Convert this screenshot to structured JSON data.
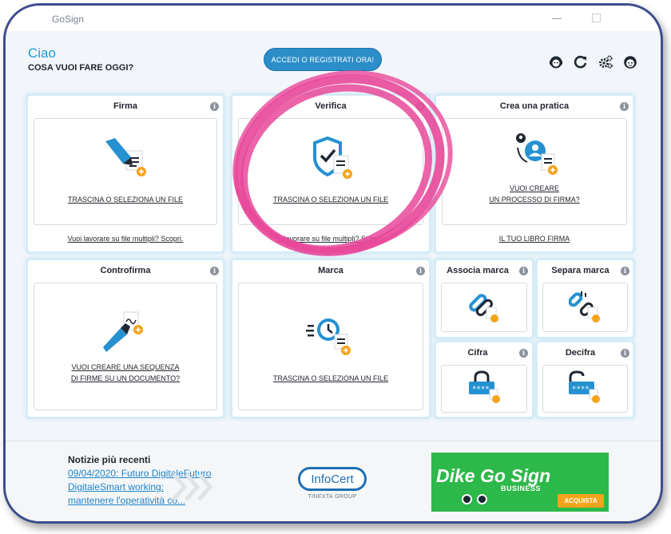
{
  "window": {
    "title": "GoSign"
  },
  "header": {
    "greeting": "Ciao",
    "question": "COSA VUOI FARE OGGI?",
    "login_button": "ACCEDI O REGISTRATI ORA!",
    "icons": [
      "user-support-icon",
      "refresh-icon",
      "settings-icon",
      "account-icon"
    ]
  },
  "panels": {
    "firma": {
      "title": "Firma",
      "action": "TRASCINA O SELEZIONA UN FILE",
      "footer_link": "Vuoi lavorare su file multipli? Scopri."
    },
    "verifica": {
      "title": "Verifica",
      "action": "TRASCINA O SELEZIONA UN FILE",
      "footer_link": "...lavorare su file multipli? Scopri."
    },
    "pratica": {
      "title": "Crea una pratica",
      "action_line1": "VUOI CREARE",
      "action_line2": "UN PROCESSO DI FIRMA?",
      "footer_link": "IL TUO LIBRO FIRMA"
    },
    "controfirma": {
      "title": "Controfirma",
      "action_line1": "VUOI CREARE UNA SEQUENZA",
      "action_line2": "DI FIRME SU UN DOCUMENTO?"
    },
    "marca": {
      "title": "Marca",
      "action": "TRASCINA O SELEZIONA UN FILE"
    },
    "associa_marca": {
      "title": "Associa marca"
    },
    "separa_marca": {
      "title": "Separa marca"
    },
    "cifra": {
      "title": "Cifra"
    },
    "decifra": {
      "title": "Decifra"
    }
  },
  "footer": {
    "news_title": "Notizie più recenti",
    "news_lines": [
      "09/04/2020: Futuro DigitaleFuturo",
      "DigitaleSmart working:",
      "mantenere l'operatività co..."
    ],
    "logo_text": "InfoCert",
    "logo_sub": "TINEXTA GROUP",
    "ad_brand": "Dike Go Sign",
    "ad_sub": "BUSINESS",
    "ad_buy": "ACQUISTA"
  },
  "colors": {
    "accent": "#1e9ad8",
    "button": "#2c8ec9",
    "highlight": "#e8489a",
    "ad_green": "#2db84a",
    "ad_orange": "#f6a31c"
  }
}
